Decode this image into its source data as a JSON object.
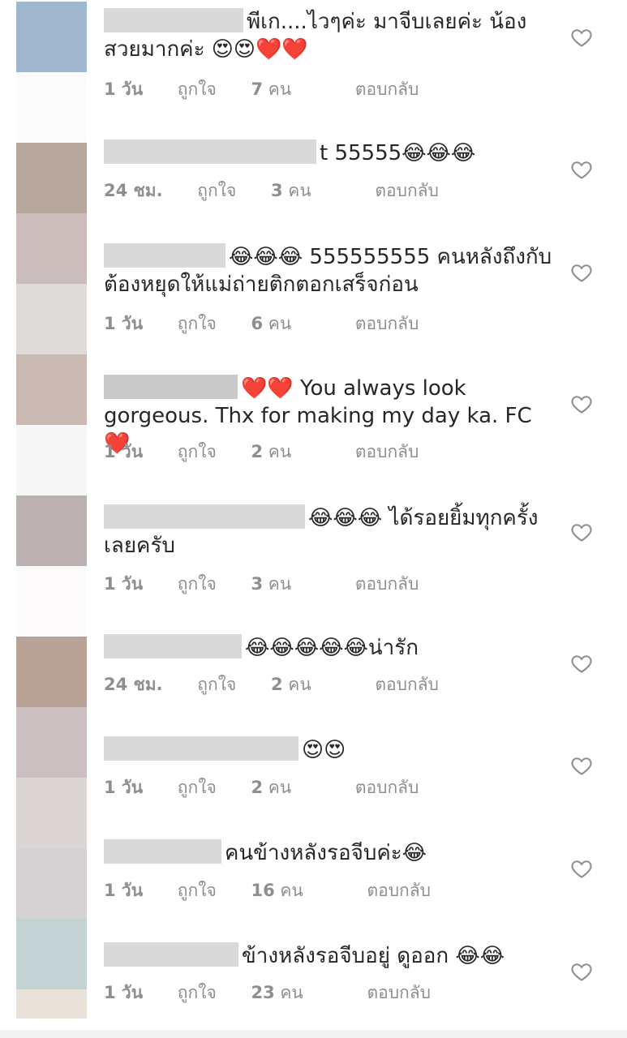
{
  "colors": {
    "meta_gray": "#8e8e8e",
    "text": "#262626",
    "heart_outline": "#8e8e8e"
  },
  "comments": [
    {
      "avatar_color": "#9fb8cf",
      "text": "พีเก....ไวๆค่ะ มาจีบเลยค่ะ น้อง สวยมากค่ะ 😍😍❤️❤️",
      "time": "1 วัน",
      "likes_prefix": "ถูกใจ",
      "likes_count": "7",
      "likes_suffix": "คน",
      "reply": "ตอบกลับ"
    },
    {
      "avatar_color": "#b7a79e",
      "text": "t 55555😂😂😂",
      "time": "24 ชม.",
      "likes_prefix": "ถูกใจ",
      "likes_count": "3",
      "likes_suffix": "คน",
      "reply": "ตอบกลับ"
    },
    {
      "avatar_color": "#cbbdbb",
      "text": "😂😂😂 555555555 คนหลังถึงกับต้องหยุดให้แม่ถ่ายติกตอกเสร็จก่อน",
      "time": "1 วัน",
      "likes_prefix": "ถูกใจ",
      "likes_count": "6",
      "likes_suffix": "คน",
      "reply": "ตอบกลับ"
    },
    {
      "avatar_color": "#cbbab4",
      "text": "❤️❤️ You always look gorgeous. Thx for making my day ka. FC ❤️",
      "time": "1 วัน",
      "likes_prefix": "ถูกใจ",
      "likes_count": "2",
      "likes_suffix": "คน",
      "reply": "ตอบกลับ"
    },
    {
      "avatar_color": "#bbb1b0",
      "text": "😂😂😂 ได้รอยยิ้มทุกครั้งเลยครับ",
      "time": "1 วัน",
      "likes_prefix": "ถูกใจ",
      "likes_count": "3",
      "likes_suffix": "คน",
      "reply": "ตอบกลับ"
    },
    {
      "avatar_color": "#b8a396",
      "text": "😂😂😂😂😂น่ารัก",
      "time": "24 ชม.",
      "likes_prefix": "ถูกใจ",
      "likes_count": "2",
      "likes_suffix": "คน",
      "reply": "ตอบกลับ"
    },
    {
      "avatar_color": "#cbbfc2",
      "text": "😍😍",
      "time": "1 วัน",
      "likes_prefix": "ถูกใจ",
      "likes_count": "2",
      "likes_suffix": "คน",
      "reply": "ตอบกลับ"
    },
    {
      "avatar_color": "#d3cfcf",
      "text": "คนข้างหลังรอจีบค่ะ😂",
      "time": "1 วัน",
      "likes_prefix": "ถูกใจ",
      "likes_count": "16",
      "likes_suffix": "คน",
      "reply": "ตอบกลับ"
    },
    {
      "avatar_color": "#c3d3d4",
      "text": "ข้างหลังรอจีบอยู่ ดูออก 😂😂",
      "time": "1 วัน",
      "likes_prefix": "ถูกใจ",
      "likes_count": "23",
      "likes_suffix": "คน",
      "reply": "ตอบกลับ"
    }
  ]
}
